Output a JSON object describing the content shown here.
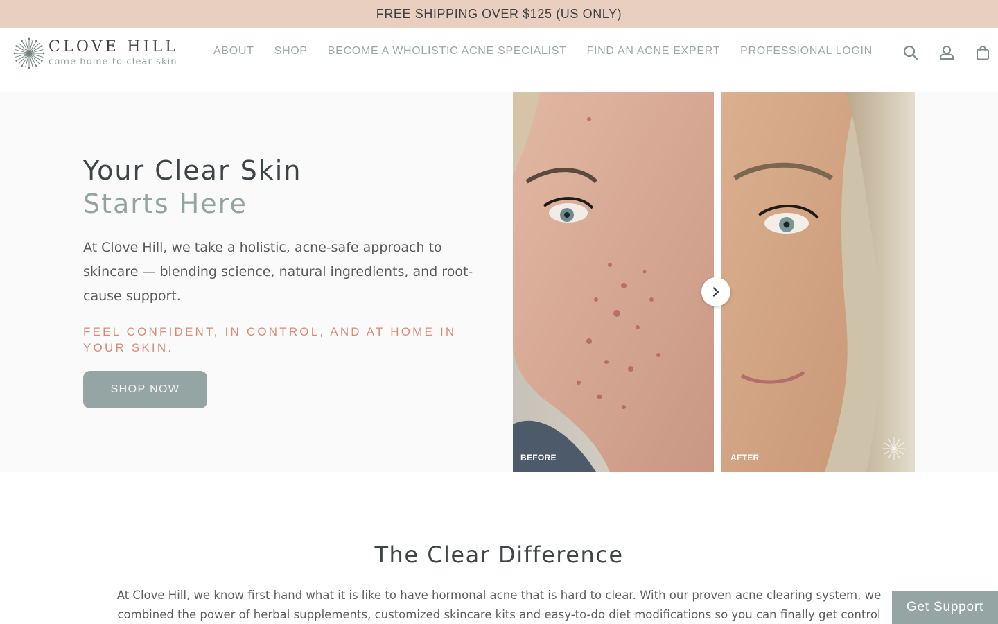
{
  "announcement": {
    "text": "FREE SHIPPING OVER $125 (US ONLY)"
  },
  "header": {
    "logo": {
      "name": "CLOVE HILL",
      "tagline": "come home to clear skin"
    },
    "nav": [
      {
        "label": "ABOUT"
      },
      {
        "label": "SHOP"
      },
      {
        "label": "BECOME A WHOLISTIC ACNE SPECIALIST"
      },
      {
        "label": "FIND AN ACNE EXPERT"
      },
      {
        "label": "PROFESSIONAL LOGIN"
      }
    ],
    "icons": [
      "search-icon",
      "account-icon",
      "cart-icon"
    ]
  },
  "hero": {
    "title_line1": "Your Clear Skin",
    "title_line2": "Starts Here",
    "body": "At Clove Hill, we take a holistic, acne-safe approach to skincare — blending science, natural ingredients, and root-cause support.",
    "tagline": "FEEL CONFIDENT, IN CONTROL, AND AT HOME IN YOUR SKIN.",
    "cta": "SHOP NOW",
    "before_label": "BEFORE",
    "after_label": "AFTER"
  },
  "difference": {
    "title": "The Clear Difference",
    "body": "At Clove Hill, we know first hand what it is like to have hormonal acne that is hard to clear. With our proven acne clearing system, we combined the power of herbal supplements, customized skincare kits and easy-to-do diet modifications so you can finally get control over"
  },
  "support": {
    "label": "Get Support"
  },
  "colors": {
    "announcement_bg": "#e8cfc0",
    "sage": "#95a5a3",
    "coral": "#d98a75",
    "title_dark": "#3f4447"
  }
}
